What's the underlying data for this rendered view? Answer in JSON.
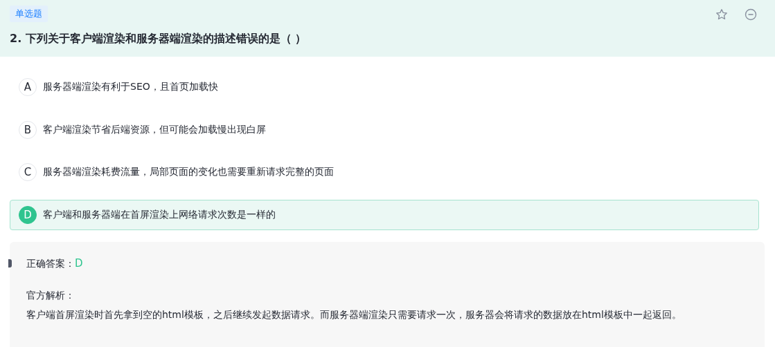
{
  "question": {
    "type_tag": "单选题",
    "title": "2. 下列关于客户端渲染和服务器端渲染的描述错误的是（   ）",
    "favorited": false
  },
  "options": [
    {
      "letter": "A",
      "text": "服务器端渲染有利于SEO，且首页加载快",
      "selected": false
    },
    {
      "letter": "B",
      "text": "客户端渲染节省后端资源，但可能会加载慢出现白屏",
      "selected": false
    },
    {
      "letter": "C",
      "text": "服务器端渲染耗费流量，局部页面的变化也需要重新请求完整的页面",
      "selected": false
    },
    {
      "letter": "D",
      "text": "客户端和服务器端在首屏渲染上网络请求次数是一样的",
      "selected": true
    }
  ],
  "answer": {
    "label": "正确答案：",
    "value": "D",
    "explanation_label": "官方解析：",
    "explanation": "客户端首屏渲染时首先拿到空的html模板，之后继续发起数据请求。而服务器端渲染只需要请求一次，服务器会将请求的数据放在html模板中一起返回。"
  }
}
